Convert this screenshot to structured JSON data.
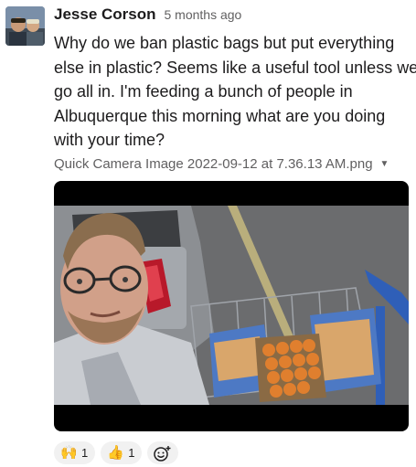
{
  "message": {
    "author": "Jesse Corson",
    "timestamp": "5 months ago",
    "text_lines": [
      "Why do we ban plastic bags but put everything",
      "else in plastic? Seems like a useful tool unless we",
      "go all in. I'm feeding a bunch of people in",
      "Albuquerque this morning what are you doing",
      "with your time?"
    ],
    "avatar_icon": "user-avatar-photo",
    "attachment": {
      "file_name": "Quick Camera Image 2022-09-12 at 7.36.13 AM.png",
      "caret_icon": "chevron-down-icon",
      "image_icon": "photo-selfie-with-shopping-cart"
    },
    "reactions": [
      {
        "emoji": "🙌",
        "icon": "raised-hands-icon",
        "count": "1"
      },
      {
        "emoji": "👍",
        "icon": "thumbs-up-icon",
        "count": "1"
      }
    ],
    "add_reaction_icon": "add-reaction-icon"
  },
  "colors": {
    "text": "#1d1c1d",
    "muted": "#616061",
    "reaction_bg": "#f1f1f1",
    "image_frame_bg": "#000000"
  }
}
